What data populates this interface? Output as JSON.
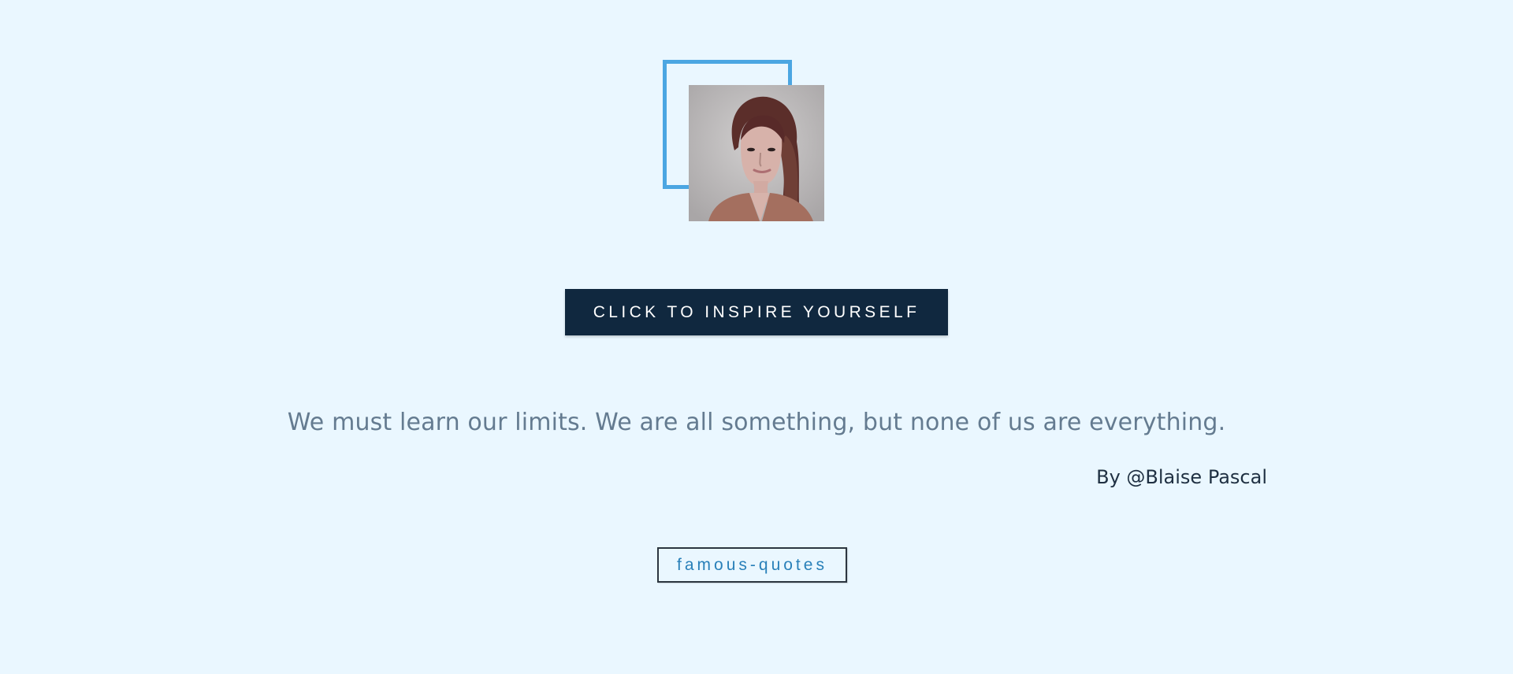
{
  "profile": {
    "avatar_icon": "portrait-photo",
    "frame_color": "#4ba6e2"
  },
  "action": {
    "inspire_label": "CLICK TO INSPIRE YOURSELF"
  },
  "quote": {
    "text": "We must learn our limits. We are all something, but none of us are everything.",
    "author": "By @Blaise Pascal"
  },
  "tag": {
    "label": "famous-quotes"
  },
  "colors": {
    "background": "#eaf7ff",
    "button": "#10283f",
    "quote_text": "#647b90",
    "author_text": "#1f3042",
    "tag_text": "#2980b9"
  }
}
